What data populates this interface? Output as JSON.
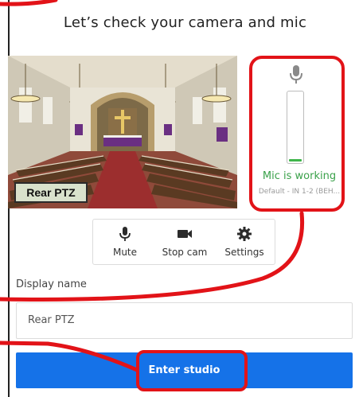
{
  "dialog": {
    "title": "Let’s check your camera and mic"
  },
  "preview": {
    "camera_label": "Rear PTZ"
  },
  "mic": {
    "icon": "microphone-icon",
    "status": "Mic is working",
    "device": "Default - IN 1-2 (BEH...",
    "level": 0.03,
    "status_color": "#3aa14a"
  },
  "controls": {
    "mute_label": "Mute",
    "mute_icon": "microphone-icon",
    "stop_cam_label": "Stop cam",
    "stop_cam_icon": "video-camera-icon",
    "settings_label": "Settings",
    "settings_icon": "gear-icon"
  },
  "form": {
    "display_name_label": "Display name",
    "display_name_value": "Rear PTZ"
  },
  "actions": {
    "enter_label": "Enter studio",
    "enter_color": "#1572e8"
  },
  "annotation": {
    "highlight_color": "#e21318"
  }
}
